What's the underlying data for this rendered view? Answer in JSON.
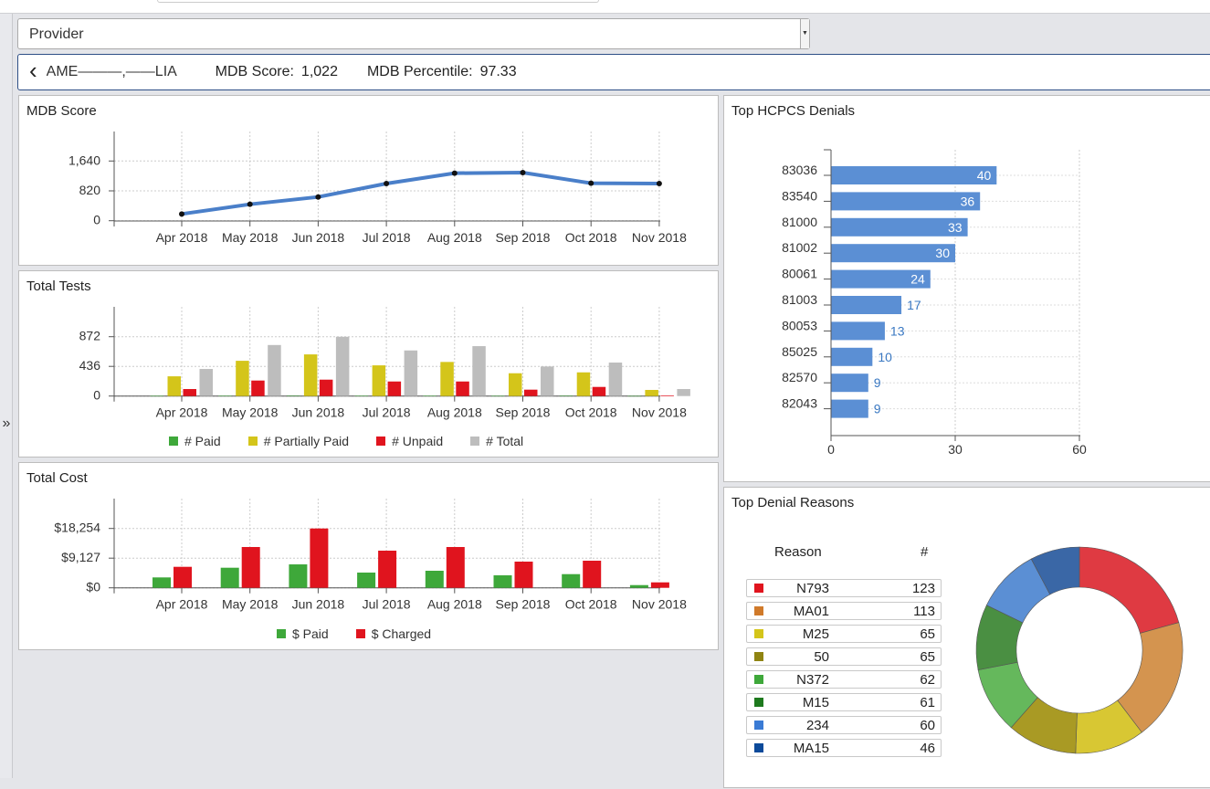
{
  "sidebar": {
    "expand_icon": "double-chevron-right-icon",
    "expand_glyph": "»"
  },
  "provider_select": {
    "value": "Provider"
  },
  "provider_header": {
    "back_icon": "chevron-left-icon",
    "back_glyph": "‹",
    "name": "AME———,——LIA",
    "score_label": "MDB Score:",
    "score_value": "1,022",
    "percentile_label": "MDB Percentile:",
    "percentile_value": "97.33"
  },
  "panels": {
    "mdb": "MDB Score",
    "tests": "Total Tests",
    "cost": "Total Cost",
    "hcpcs": "Top HCPCS Denials",
    "reasons": "Top Denial Reasons"
  },
  "chart_data": [
    {
      "type": "line",
      "title": "MDB Score",
      "categories": [
        "Apr 2018",
        "May 2018",
        "Jun 2018",
        "Jul 2018",
        "Aug 2018",
        "Sep 2018",
        "Oct 2018",
        "Nov 2018"
      ],
      "series": [
        {
          "values": [
            185,
            452,
            652,
            1020,
            1305,
            1322,
            1030,
            1022
          ],
          "color": "#4a7fc9"
        }
      ],
      "yticks": [
        "0",
        "820",
        "1,640"
      ],
      "ytick_values": [
        0,
        820,
        1640
      ],
      "ylim": [
        -480,
        1950
      ],
      "grid": true
    },
    {
      "type": "bar",
      "title": "Total Tests",
      "categories": [
        "Apr 2018",
        "May 2018",
        "Jun 2018",
        "Jul 2018",
        "Aug 2018",
        "Sep 2018",
        "Oct 2018",
        "Nov 2018"
      ],
      "series": [
        {
          "name": "# Paid",
          "color": "#3ea83a",
          "values": [
            2,
            3,
            6,
            3,
            3,
            2,
            5,
            1
          ]
        },
        {
          "name": "# Partially Paid",
          "color": "#d4c51a",
          "values": [
            290,
            518,
            612,
            451,
            501,
            335,
            348,
            90
          ]
        },
        {
          "name": "# Unpaid",
          "color": "#e0141e",
          "values": [
            103,
            228,
            241,
            214,
            214,
            94,
            134,
            10
          ]
        },
        {
          "name": "# Total",
          "color": "#bdbdbd",
          "values": [
            398,
            750,
            871,
            670,
            733,
            434,
            492,
            103
          ]
        }
      ],
      "yticks": [
        "0",
        "436",
        "872"
      ],
      "ytick_values": [
        0,
        436,
        872
      ],
      "ylim": [
        0,
        1308
      ],
      "legend": "bottom",
      "grid": true
    },
    {
      "type": "bar",
      "title": "Total Cost",
      "categories": [
        "Apr 2018",
        "May 2018",
        "Jun 2018",
        "Jul 2018",
        "Aug 2018",
        "Sep 2018",
        "Oct 2018",
        "Nov 2018"
      ],
      "series": [
        {
          "name": "$ Paid",
          "color": "#3ea83a",
          "values": [
            3200,
            6180,
            7210,
            4690,
            5250,
            3850,
            4210,
            840
          ]
        },
        {
          "name": "$ Charged",
          "color": "#e0141e",
          "values": [
            6460,
            12550,
            18250,
            11430,
            12550,
            8060,
            8340,
            1680
          ]
        }
      ],
      "yticks": [
        "$0",
        "$9,127",
        "$18,254"
      ],
      "ytick_values": [
        0,
        9127,
        18254
      ],
      "ylim": [
        0,
        27381
      ],
      "legend": "bottom",
      "grid": true
    },
    {
      "type": "bar",
      "orientation": "horizontal",
      "title": "Top HCPCS Denials",
      "categories": [
        "83036",
        "83540",
        "81000",
        "81002",
        "80061",
        "81003",
        "80053",
        "85025",
        "82570",
        "82043"
      ],
      "values": [
        40,
        36,
        33,
        30,
        24,
        17,
        13,
        10,
        9,
        9
      ],
      "xticks": [
        "0",
        "30",
        "60"
      ],
      "xtick_values": [
        0,
        30,
        60
      ],
      "xlim": [
        0,
        60
      ],
      "color": "#5b8fd4",
      "grid": true
    },
    {
      "type": "pie",
      "donut": true,
      "title": "Top Denial Reasons",
      "columns": [
        "Reason",
        "#"
      ],
      "labels": [
        "N793",
        "MA01",
        "M25",
        "50",
        "N372",
        "M15",
        "234",
        "MA15"
      ],
      "values": [
        123,
        113,
        65,
        65,
        62,
        61,
        60,
        46
      ],
      "legend_colors": [
        "#e0141e",
        "#d07a2a",
        "#d4c51a",
        "#8f8412",
        "#3ea83a",
        "#1e7a1e",
        "#3a7bd5",
        "#0c4a9a"
      ],
      "slice_colors": [
        "#df3a42",
        "#d4944f",
        "#d8c733",
        "#a99a24",
        "#65b85c",
        "#4a8f42",
        "#5b8fd4",
        "#3a67a6"
      ]
    }
  ]
}
